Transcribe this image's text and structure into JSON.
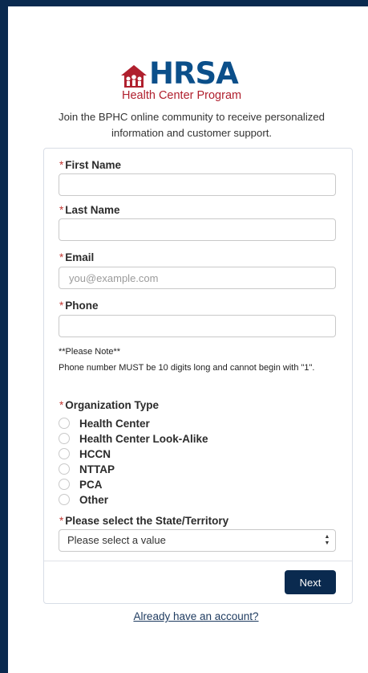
{
  "logo": {
    "title": "HRSA",
    "subtitle": "Health Center Program"
  },
  "intro": "Join the BPHC online community to receive personalized information and customer support.",
  "required_mark": "*",
  "form": {
    "first_name": {
      "label": "First Name",
      "value": "",
      "placeholder": ""
    },
    "last_name": {
      "label": "Last Name",
      "value": "",
      "placeholder": ""
    },
    "email": {
      "label": "Email",
      "value": "",
      "placeholder": "you@example.com"
    },
    "phone": {
      "label": "Phone",
      "value": "",
      "placeholder": ""
    },
    "phone_note_title": "**Please Note**",
    "phone_note_body": "Phone number MUST be 10 digits long and cannot begin with \"1\".",
    "org_type": {
      "label": "Organization Type",
      "options": [
        "Health Center",
        "Health Center Look-Alike",
        "HCCN",
        "NTTAP",
        "PCA",
        "Other"
      ]
    },
    "state": {
      "label": "Please select the State/Territory",
      "selected": "Please select a value"
    }
  },
  "next_button": "Next",
  "account_link": "Already have an account?",
  "colors": {
    "brand_navy": "#0a2a4f",
    "hrsa_blue": "#0b4f8a",
    "required_red": "#c23934",
    "logo_red": "#b0202e"
  }
}
